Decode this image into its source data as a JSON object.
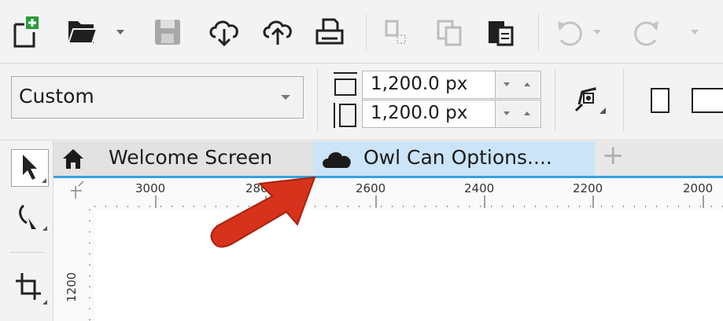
{
  "toolbar": {
    "buttons": [
      {
        "name": "new-document",
        "icon": "new-document-icon"
      },
      {
        "name": "open",
        "icon": "folder-open-icon"
      },
      {
        "name": "save",
        "icon": "save-icon"
      },
      {
        "name": "import-cloud",
        "icon": "cloud-download-icon"
      },
      {
        "name": "export-cloud",
        "icon": "cloud-upload-icon"
      },
      {
        "name": "print",
        "icon": "print-icon"
      },
      {
        "name": "cut",
        "icon": "cut-icon"
      },
      {
        "name": "copy",
        "icon": "copy-icon"
      },
      {
        "name": "paste",
        "icon": "paste-icon"
      },
      {
        "name": "undo",
        "icon": "undo-icon"
      },
      {
        "name": "redo",
        "icon": "redo-icon"
      }
    ]
  },
  "property_bar": {
    "page_size_preset": "Custom",
    "width_value": "1,200.0 px",
    "height_value": "1,200.0 px"
  },
  "tabs": [
    {
      "label": "Welcome Screen",
      "icon": "home-icon",
      "active": false
    },
    {
      "label": "Owl Can Options....",
      "icon": "cloud-icon",
      "active": true
    }
  ],
  "new_tab_label": "+",
  "ruler": {
    "horizontal_labels": [
      "3000",
      "2800",
      "2600",
      "2400",
      "2200",
      "2000"
    ],
    "vertical_labels": [
      "1200"
    ]
  },
  "colors": {
    "active_tab": "#cce4f7",
    "tab_underline": "#36a2de",
    "annotation_arrow": "#d7321b"
  }
}
